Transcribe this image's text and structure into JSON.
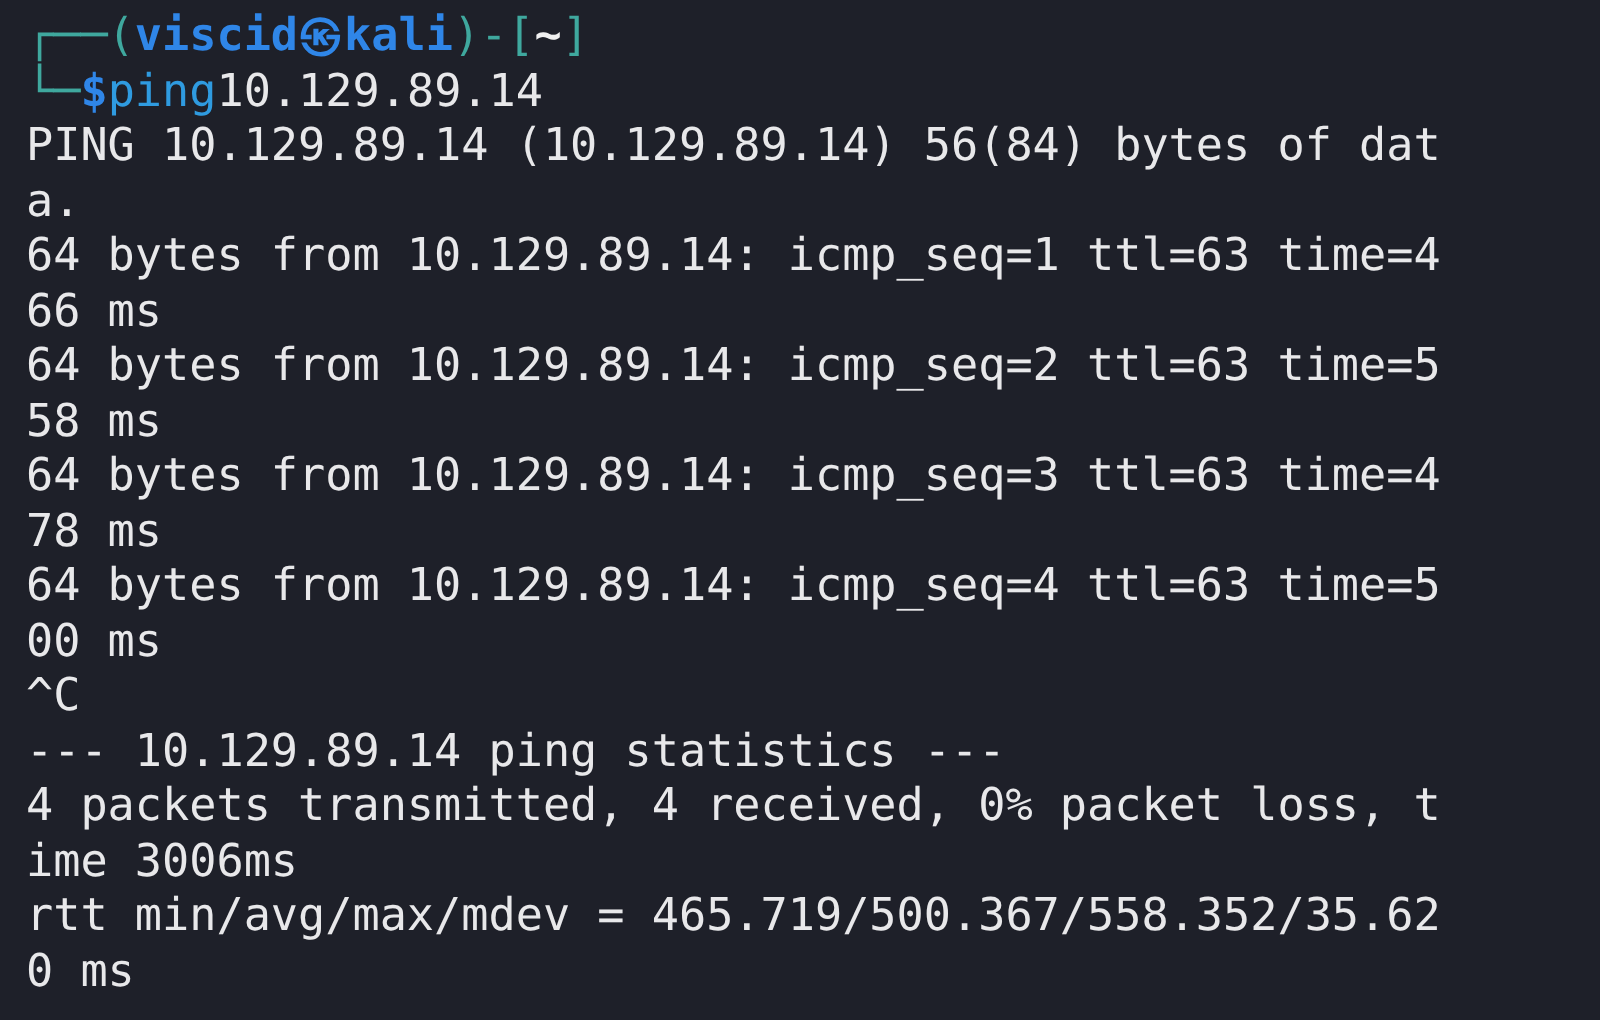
{
  "prompt_line": [
    {
      "kind": "frame",
      "text": "┌──("
    },
    {
      "kind": "user",
      "text": "viscid"
    },
    {
      "kind": "at",
      "text": "㉿"
    },
    {
      "kind": "host",
      "text": "kali"
    },
    {
      "kind": "frame",
      "text": ")-["
    },
    {
      "kind": "dir",
      "text": "~"
    },
    {
      "kind": "frame",
      "text": "]"
    }
  ],
  "command_line": [
    {
      "kind": "frame",
      "text": "└─"
    },
    {
      "kind": "sign",
      "text": "$"
    },
    {
      "kind": "program",
      "text": "ping"
    },
    {
      "kind": "args",
      "text": "10.129.89.14"
    }
  ],
  "output": [
    "PING 10.129.89.14 (10.129.89.14) 56(84) bytes of dat",
    "a.",
    "64 bytes from 10.129.89.14: icmp_seq=1 ttl=63 time=4",
    "66 ms",
    "64 bytes from 10.129.89.14: icmp_seq=2 ttl=63 time=5",
    "58 ms",
    "64 bytes from 10.129.89.14: icmp_seq=3 ttl=63 time=4",
    "78 ms",
    "64 bytes from 10.129.89.14: icmp_seq=4 ttl=63 time=5",
    "00 ms",
    "^C",
    "--- 10.129.89.14 ping statistics ---",
    "4 packets transmitted, 4 received, 0% packet loss, t",
    "ime 3006ms",
    "rtt min/avg/max/mdev = 465.719/500.367/558.352/35.62",
    "0 ms"
  ]
}
